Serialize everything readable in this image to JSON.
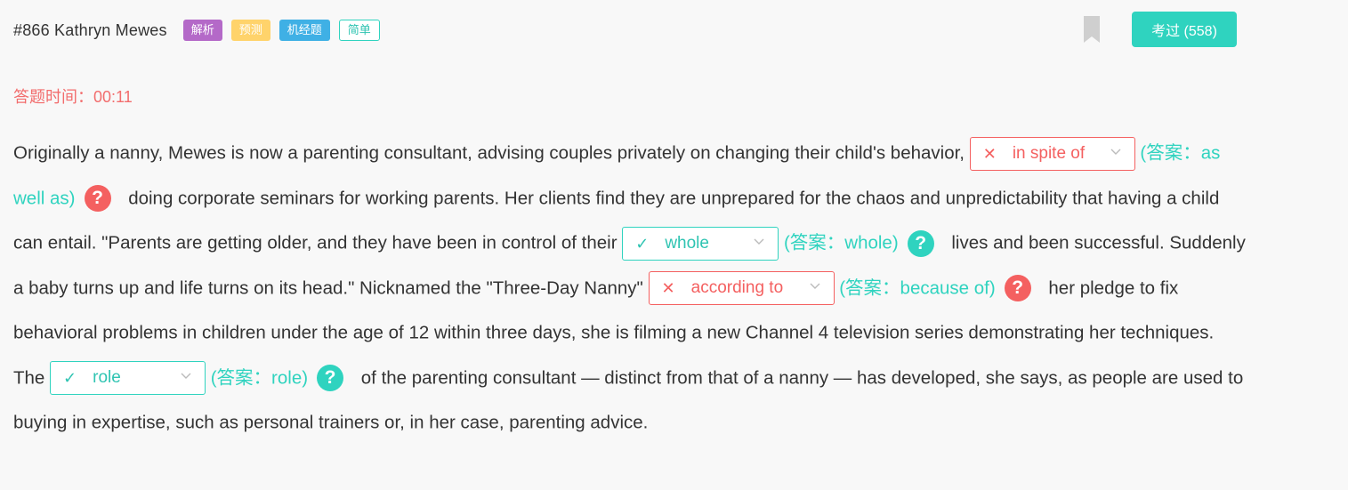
{
  "header": {
    "question_id": "#866 Kathryn Mewes",
    "tags": [
      "解析",
      "预测",
      "机经题",
      "简单"
    ],
    "exam_button": "考过 (558)"
  },
  "timer": "答题时间：00:11",
  "passage": {
    "t1": "Originally a nanny, Mewes is now a parenting consultant, advising couples privately on changing their child's behavior,",
    "blank1": {
      "value": "in spite of",
      "status": "wrong",
      "answer": "(答案：as well as)"
    },
    "t2": "doing corporate seminars for working parents. Her clients find they are unprepared for the chaos and unpredictability that having a child can entail. \"Parents are getting older, and they have been in control of their",
    "blank2": {
      "value": "whole",
      "status": "right",
      "answer": "(答案：whole)"
    },
    "t3": "lives and been successful. Suddenly a baby turns up and life turns on its head.\" Nicknamed the \"Three-Day Nanny\"",
    "blank3": {
      "value": "according to",
      "status": "wrong",
      "answer": "(答案：because of)"
    },
    "t4": "her pledge to fix behavioral problems in children under the age of 12 within three days, she is filming a new Channel 4 television series demonstrating her techniques. The",
    "blank4": {
      "value": "role",
      "status": "right",
      "answer": "(答案：role)"
    },
    "t5": "of the parenting consultant — distinct from that of a nanny — has developed, she says, as people are used to buying in expertise, such as personal trainers or, in her case, parenting advice."
  },
  "icons": {
    "wrong": "✕",
    "right": "✓",
    "help": "?"
  },
  "colors": {
    "teal": "#2fd3bf",
    "red": "#f46060",
    "timer": "#f26d6d",
    "tag_purple": "#b469c8",
    "tag_orange": "#ffd36b",
    "tag_blue": "#3fb0e5"
  }
}
